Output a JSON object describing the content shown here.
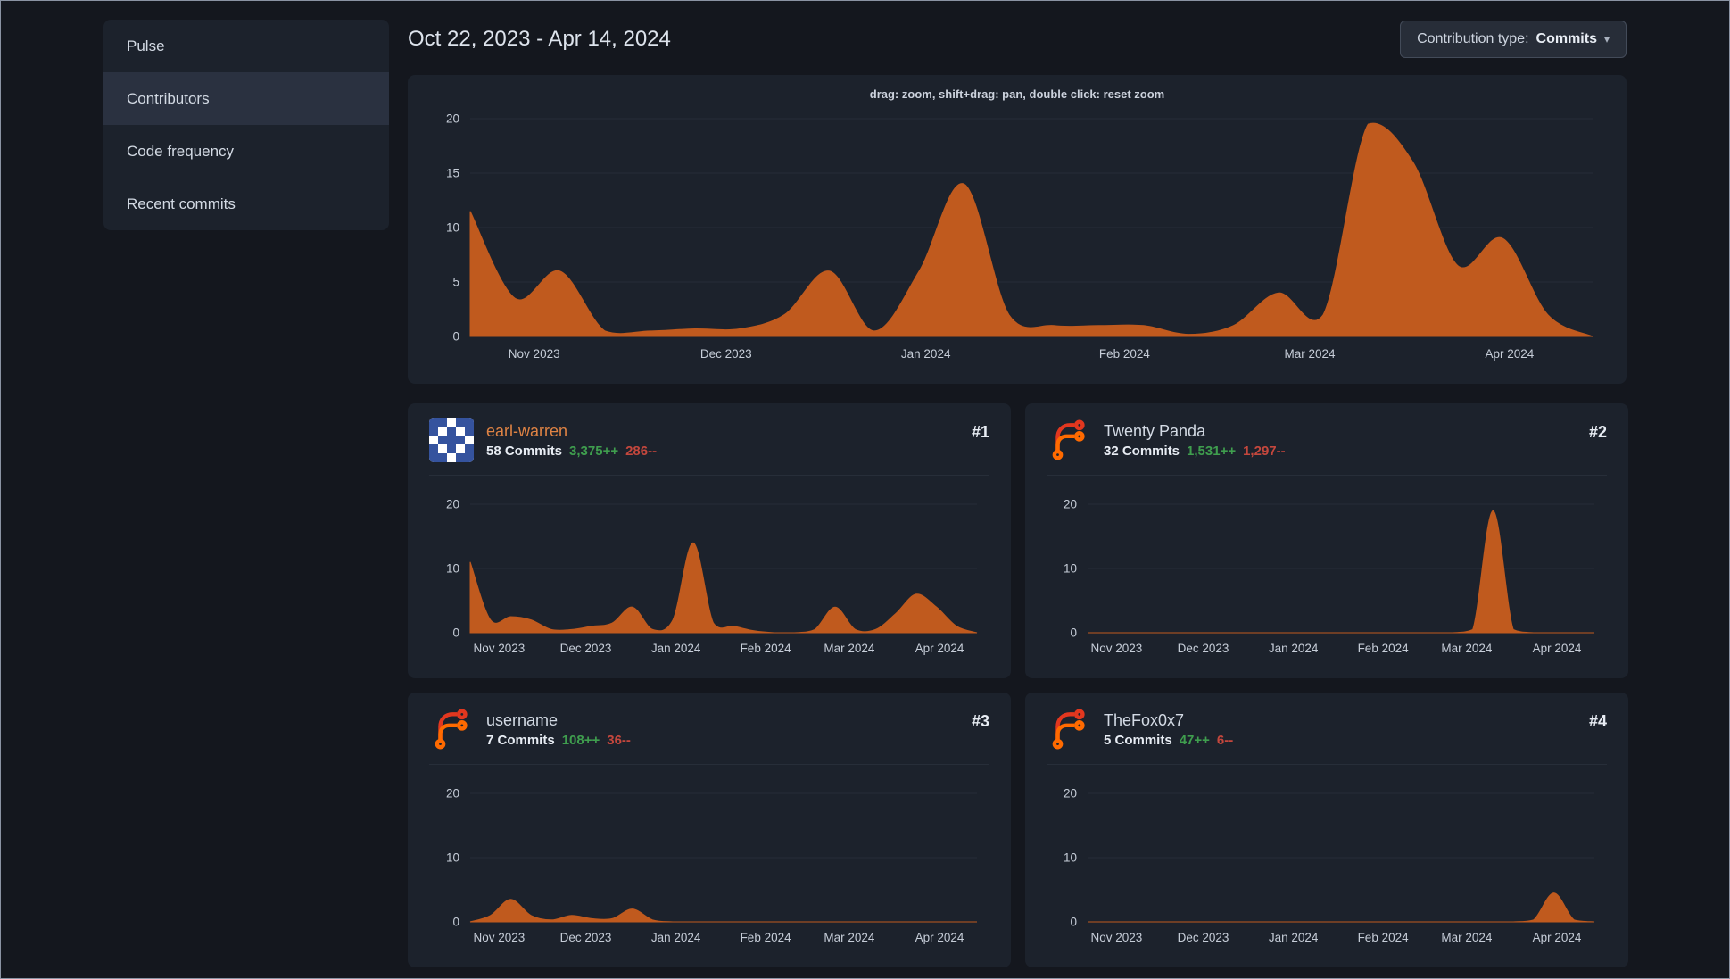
{
  "colors": {
    "page_bg": "#14171e",
    "card_bg": "#1c222c",
    "card_border": "#272e39",
    "menu_active_bg": "#2a3140",
    "text": "#d3dae4",
    "axis_text": "#c6cdd8",
    "grid_line": "#262c37",
    "chart_fill": "#c05a1e",
    "link_orange": "#df8344",
    "additions_green": "#3f9e4e",
    "deletions_red": "#c4473d",
    "button_bg": "#272d38",
    "button_border": "#434b59"
  },
  "sidebar": {
    "items": [
      {
        "label": "Pulse",
        "active": false
      },
      {
        "label": "Contributors",
        "active": true
      },
      {
        "label": "Code frequency",
        "active": false
      },
      {
        "label": "Recent commits",
        "active": false
      }
    ]
  },
  "header": {
    "date_range": "Oct 22, 2023 - Apr 14, 2024",
    "contribution_type_label": "Contribution type:",
    "contribution_type_value": "Commits",
    "dropdown_caret": "▾"
  },
  "main_chart": {
    "hint": "drag: zoom, shift+drag: pan, double click: reset zoom"
  },
  "contributors": [
    {
      "rank": "#1",
      "name": "earl-warren",
      "name_color": "#df8344",
      "avatar": "identicon-blue-white",
      "commits": "58 Commits",
      "additions": "3,375++",
      "deletions": "286--"
    },
    {
      "rank": "#2",
      "name": "Twenty Panda",
      "name_color": "#d3dae4",
      "avatar": "forgejo-logo",
      "commits": "32 Commits",
      "additions": "1,531++",
      "deletions": "1,297--"
    },
    {
      "rank": "#3",
      "name": "username",
      "name_color": "#d3dae4",
      "avatar": "forgejo-logo",
      "commits": "7 Commits",
      "additions": "108++",
      "deletions": "36--"
    },
    {
      "rank": "#4",
      "name": "TheFox0x7",
      "name_color": "#d3dae4",
      "avatar": "forgejo-logo",
      "commits": "5 Commits",
      "additions": "47++",
      "deletions": "6--"
    }
  ],
  "chart_data": {
    "type": "area",
    "x_axis": {
      "unit": "week",
      "start": "Oct 22, 2023",
      "end": "Apr 14, 2024",
      "ticks": [
        {
          "label": "Nov 2023",
          "frac": 0.057
        },
        {
          "label": "Dec 2023",
          "frac": 0.228
        },
        {
          "label": "Jan 2024",
          "frac": 0.406
        },
        {
          "label": "Feb 2024",
          "frac": 0.583
        },
        {
          "label": "Mar 2024",
          "frac": 0.748
        },
        {
          "label": "Apr 2024",
          "frac": 0.926
        }
      ]
    },
    "ylim": [
      0,
      20
    ],
    "grid": true,
    "legend": "none",
    "charts": [
      {
        "id": "total-commits-per-week",
        "yticks": [
          0,
          5,
          10,
          15,
          20
        ],
        "values": [
          11.5,
          3.5,
          6,
          0.5,
          0.5,
          0.7,
          0.7,
          2,
          6,
          0.5,
          6,
          14,
          2,
          1,
          1,
          1,
          0.2,
          1,
          4,
          2,
          19.5,
          16,
          6.5,
          9,
          2,
          0
        ]
      },
      {
        "id": "earl-warren-commits",
        "yticks": [
          0,
          10,
          20
        ],
        "values": [
          11,
          2,
          2.5,
          2,
          0.5,
          0.5,
          1,
          1.5,
          4,
          0.5,
          2,
          14,
          1.5,
          1,
          0.3,
          0,
          0,
          0.5,
          4,
          0.5,
          0.5,
          3,
          6,
          4,
          1,
          0
        ]
      },
      {
        "id": "twenty-panda-commits",
        "yticks": [
          0,
          10,
          20
        ],
        "values": [
          0,
          0,
          0,
          0,
          0,
          0,
          0,
          0,
          0,
          0,
          0,
          0,
          0,
          0,
          0,
          0,
          0,
          0,
          0,
          0.5,
          19,
          0.5,
          0,
          0,
          0,
          0
        ]
      },
      {
        "id": "username-commits",
        "yticks": [
          0,
          10,
          20
        ],
        "values": [
          0,
          1,
          3.5,
          1,
          0.3,
          1,
          0.5,
          0.5,
          2,
          0.3,
          0,
          0,
          0,
          0,
          0,
          0,
          0,
          0,
          0,
          0,
          0,
          0,
          0,
          0,
          0,
          0
        ]
      },
      {
        "id": "thefox0x7-commits",
        "yticks": [
          0,
          10,
          20
        ],
        "values": [
          0,
          0,
          0,
          0,
          0,
          0,
          0,
          0,
          0,
          0,
          0,
          0,
          0,
          0,
          0,
          0,
          0,
          0,
          0,
          0,
          0,
          0,
          0.3,
          4.5,
          0.3,
          0
        ]
      }
    ]
  }
}
